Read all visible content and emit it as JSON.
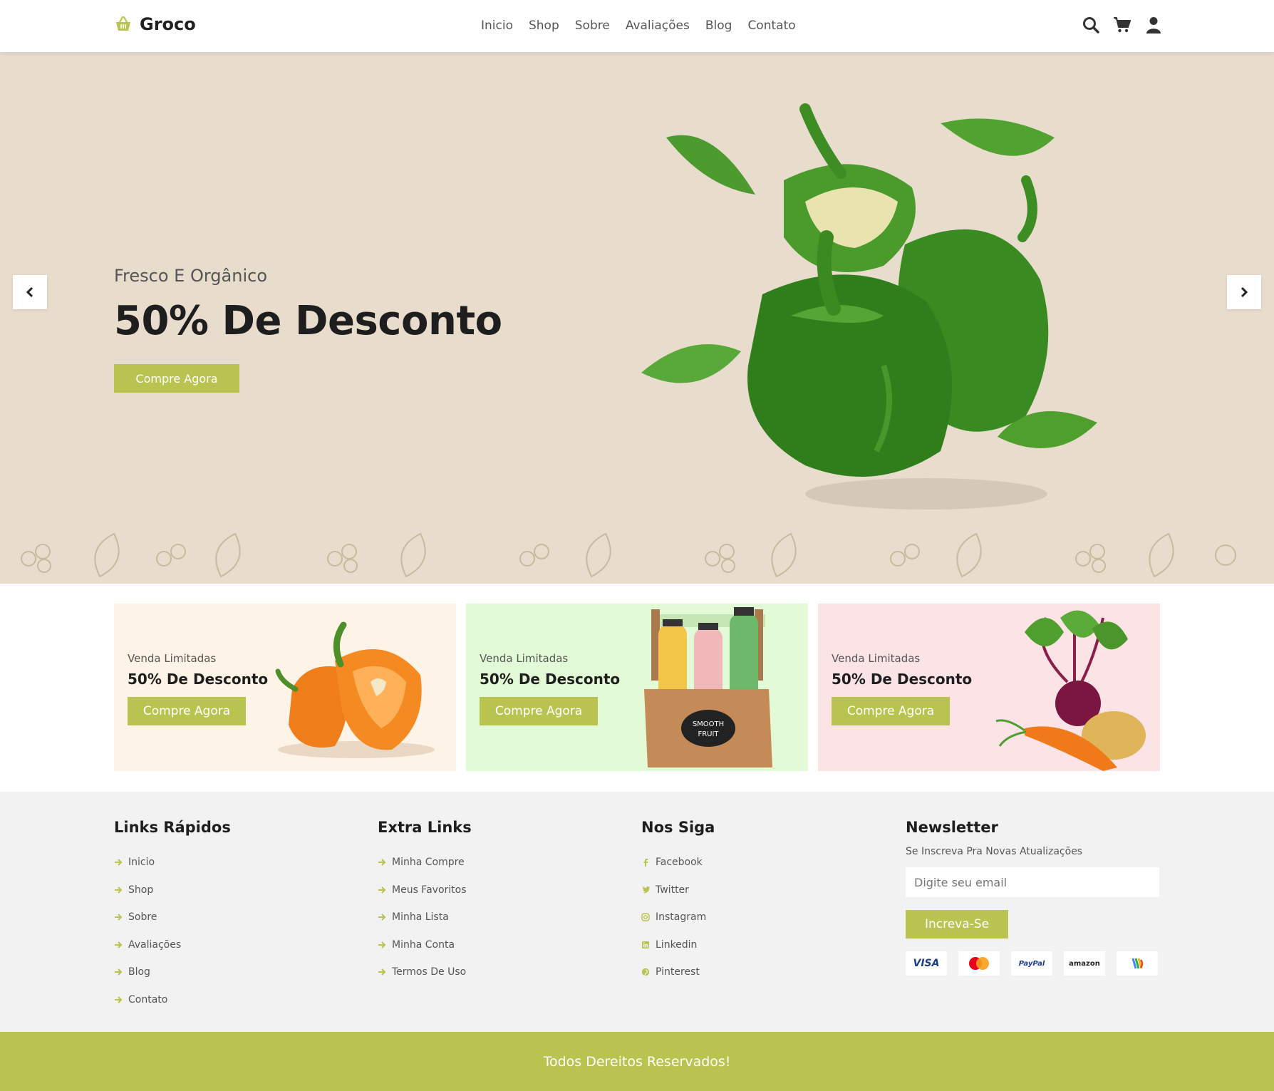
{
  "brand": {
    "name": "Groco",
    "accent": "#b8c350"
  },
  "nav": {
    "items": [
      {
        "label": "Inicio"
      },
      {
        "label": "Shop"
      },
      {
        "label": "Sobre"
      },
      {
        "label": "Avaliações"
      },
      {
        "label": "Blog"
      },
      {
        "label": "Contato"
      }
    ]
  },
  "header_icons": [
    "search-icon",
    "cart-icon",
    "user-icon"
  ],
  "hero": {
    "subtitle": "Fresco E Orgânico",
    "title": "50% De Desconto",
    "button": "Compre Agora",
    "background": "#e8dccd"
  },
  "promos": [
    {
      "subtitle": "Venda Limitadas",
      "title": "50% De Desconto",
      "button": "Compre Agora",
      "background": "#fdf3e6"
    },
    {
      "subtitle": "Venda Limitadas",
      "title": "50% De Desconto",
      "button": "Compre Agora",
      "background": "#e3fad7"
    },
    {
      "subtitle": "Venda Limitadas",
      "title": "50% De Desconto",
      "button": "Compre Agora",
      "background": "#fbe3e6"
    }
  ],
  "footer": {
    "quick_links": {
      "title": "Links Rápidos",
      "items": [
        "Inicio",
        "Shop",
        "Sobre",
        "Avaliações",
        "Blog",
        "Contato"
      ]
    },
    "extra_links": {
      "title": "Extra Links",
      "items": [
        "Minha Compre",
        "Meus Favoritos",
        "Minha Lista",
        "Minha Conta",
        "Termos De Uso"
      ]
    },
    "social": {
      "title": "Nos Siga",
      "items": [
        "Facebook",
        "Twitter",
        "Instagram",
        "Linkedin",
        "Pinterest"
      ]
    },
    "newsletter": {
      "title": "Newsletter",
      "text": "Se Inscreva Pra Novas Atualizações",
      "placeholder": "Digite seu email",
      "button": "Increva-Se",
      "payments": [
        "VISA",
        "mastercard",
        "PayPal",
        "amazon",
        "gpay"
      ]
    }
  },
  "copyright": "Todos Dereitos Reservados!"
}
